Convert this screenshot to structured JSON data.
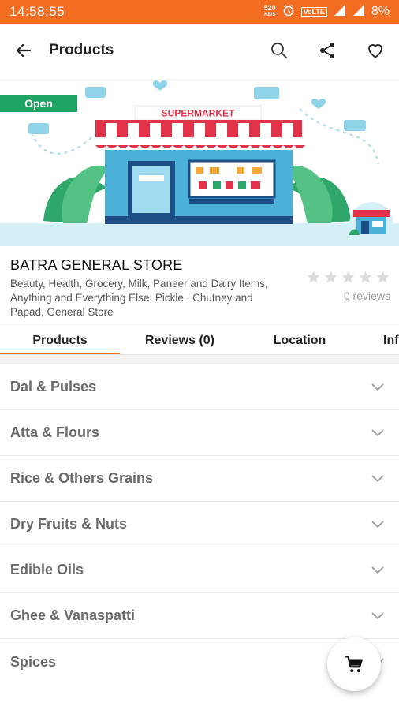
{
  "status_bar": {
    "time": "14:58:55",
    "speed_value": "520",
    "speed_unit": "KB/S",
    "volte": "VoLTE",
    "battery": "8%"
  },
  "app_bar": {
    "title": "Products",
    "back_icon": "arrow-back-icon",
    "search_icon": "search-icon",
    "share_icon": "share-icon",
    "favorite_icon": "heart-icon"
  },
  "banner": {
    "open_label": "Open",
    "sign_text": "SUPERMARKET"
  },
  "store": {
    "name": "BATRA GENERAL STORE",
    "categories": "Beauty, Health, Grocery, Milk, Paneer and Dairy Items, Anything and Everything Else, Pickle , Chutney and Papad, General Store",
    "reviews_count_label": "0 reviews",
    "rating": 0,
    "rating_max": 5
  },
  "tabs": [
    {
      "label": "Products",
      "active": true
    },
    {
      "label": "Reviews (0)",
      "active": false
    },
    {
      "label": "Location",
      "active": false
    },
    {
      "label": "Inf",
      "active": false
    }
  ],
  "categories": [
    {
      "label": "Dal & Pulses"
    },
    {
      "label": "Atta & Flours"
    },
    {
      "label": "Rice & Others Grains"
    },
    {
      "label": "Dry Fruits & Nuts"
    },
    {
      "label": "Edible Oils"
    },
    {
      "label": "Ghee & Vanaspatti"
    },
    {
      "label": "Spices"
    }
  ],
  "fab": {
    "icon": "cart-icon"
  },
  "colors": {
    "accent": "#f26c22",
    "open_badge": "#1fa463",
    "category_text": "#6a6a6a"
  }
}
